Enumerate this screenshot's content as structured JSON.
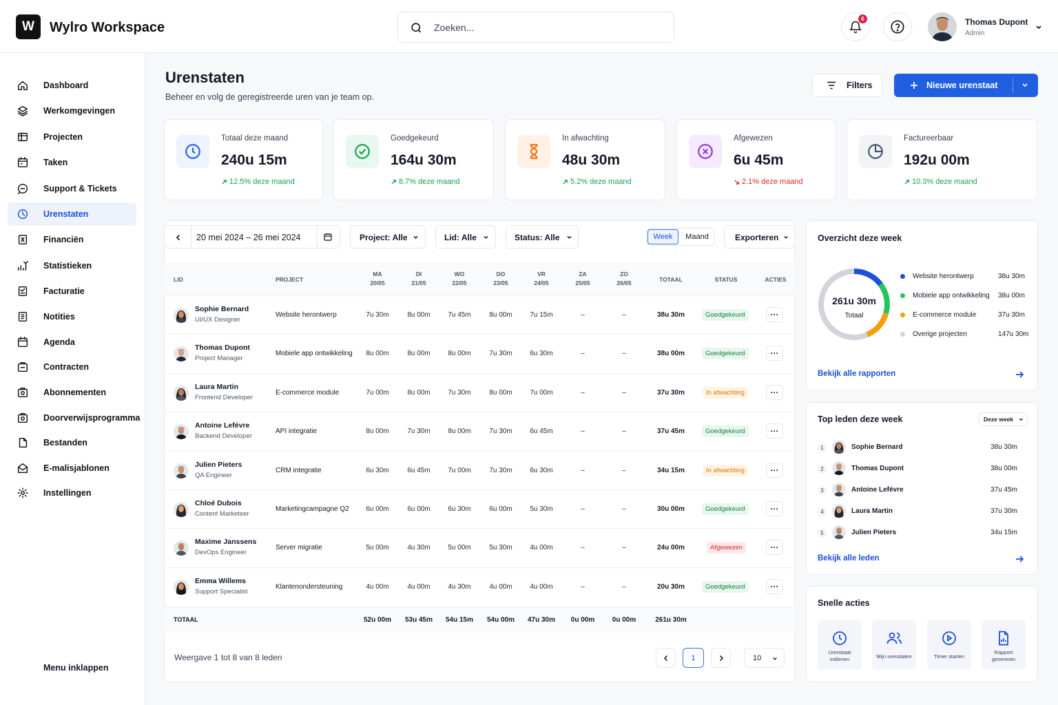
{
  "app": {
    "logo_letter": "W",
    "name": "Wylro Workspace"
  },
  "search": {
    "placeholder": "Zoeken..."
  },
  "notifications": {
    "count": "6"
  },
  "user": {
    "name": "Thomas Dupont",
    "role": "Admin"
  },
  "sidebar": {
    "items": [
      {
        "label": "Dashboard",
        "icon": "home-icon"
      },
      {
        "label": "Werkomgevingen",
        "icon": "layers-icon"
      },
      {
        "label": "Projecten",
        "icon": "folder-icon"
      },
      {
        "label": "Taken",
        "icon": "calendar-icon"
      },
      {
        "label": "Support & Tickets",
        "icon": "chat-icon"
      },
      {
        "label": "Urenstaten",
        "icon": "clock-icon",
        "active": true
      },
      {
        "label": "Financiën",
        "icon": "finance-icon"
      },
      {
        "label": "Statistieken",
        "icon": "stats-icon"
      },
      {
        "label": "Facturatie",
        "icon": "invoice-icon"
      },
      {
        "label": "Notities",
        "icon": "notes-icon"
      },
      {
        "label": "Agenda",
        "icon": "agenda-icon"
      },
      {
        "label": "Contracten",
        "icon": "contract-icon"
      },
      {
        "label": "Abonnementen",
        "icon": "subscription-icon"
      },
      {
        "label": "Doorverwijsprogramma",
        "icon": "referral-icon"
      },
      {
        "label": "Bestanden",
        "icon": "files-icon"
      },
      {
        "label": "E-malisjablonen",
        "icon": "mail-icon"
      },
      {
        "label": "Instellingen",
        "icon": "gear-icon"
      }
    ],
    "collapse_label": "Menu inklappen"
  },
  "page": {
    "title": "Urenstaten",
    "subtitle": "Beheer en volg de geregistreerde uren van je team op.",
    "filters_label": "Filters",
    "new_label": "Nieuwe urenstaat"
  },
  "stats": [
    {
      "label": "Totaal deze maand",
      "value": "240u 15m",
      "trend": "12.5% deze maand",
      "color": "#2563eb"
    },
    {
      "label": "Goedgekeurd",
      "value": "164u 30m",
      "trend": "8.7% deze maand",
      "color": "#16a34a"
    },
    {
      "label": "In afwachting",
      "value": "48u 30m",
      "trend": "5.2% deze maand",
      "color": "#f97316"
    },
    {
      "label": "Afgewezen",
      "value": "6u 45m",
      "trend": "2.1% deze maand",
      "color": "#9333ea"
    },
    {
      "label": "Factureerbaar",
      "value": "192u 00m",
      "trend": "10.3% deze maand",
      "color": "#475569"
    }
  ],
  "controls": {
    "date_range": "20 mei 2024 – 26 mei 2024",
    "project": "Project: Alle",
    "member": "Lid: Alle",
    "status": "Status: Alle",
    "week": "Week",
    "month": "Maand",
    "export": "Exporteren"
  },
  "table": {
    "headers": {
      "member": "LID",
      "project": "PROJECT",
      "total": "TOTAAL",
      "status": "STATUS",
      "actions": "ACTIES"
    },
    "days": [
      {
        "d": "MA",
        "date": "20/05"
      },
      {
        "d": "DI",
        "date": "21/05"
      },
      {
        "d": "WO",
        "date": "22/05"
      },
      {
        "d": "DO",
        "date": "23/05"
      },
      {
        "d": "VR",
        "date": "24/05"
      },
      {
        "d": "ZA",
        "date": "25/05"
      },
      {
        "d": "ZO",
        "date": "26/05"
      }
    ],
    "rows": [
      {
        "name": "Sophie Bernard",
        "role": "UI/UX Designer",
        "project": "Website herontwerp",
        "hours": [
          "7u 30m",
          "8u 00m",
          "7u 45m",
          "8u 00m",
          "7u 15m",
          "–",
          "–"
        ],
        "total": "38u 30m",
        "status": "Goedgekeurd"
      },
      {
        "name": "Thomas Dupont",
        "role": "Project Manager",
        "project": "Mobiele app ontwikkeling",
        "hours": [
          "8u 00m",
          "8u 00m",
          "8u 00m",
          "7u 30m",
          "6u 30m",
          "–",
          "–"
        ],
        "total": "38u 00m",
        "status": "Goedgekeurd"
      },
      {
        "name": "Laura Martin",
        "role": "Frontend Developer",
        "project": "E-commerce module",
        "hours": [
          "7u 00m",
          "8u 00m",
          "7u 30m",
          "8u 00m",
          "7u 00m",
          "–",
          "–"
        ],
        "total": "37u 30m",
        "status": "In afwachting"
      },
      {
        "name": "Antoine Lefévre",
        "role": "Backend Developer",
        "project": "API integratie",
        "hours": [
          "8u 00m",
          "7u 30m",
          "8u 00m",
          "7u 30m",
          "6u 45m",
          "–",
          "–"
        ],
        "total": "37u 45m",
        "status": "Goedgekeurd"
      },
      {
        "name": "Julien Pieters",
        "role": "QA Engineer",
        "project": "CRM integratie",
        "hours": [
          "6u 30m",
          "6u 45m",
          "7u 00m",
          "7u 30m",
          "6u 30m",
          "–",
          "–"
        ],
        "total": "34u 15m",
        "status": "In afwachting"
      },
      {
        "name": "Chloé Dubois",
        "role": "Content Marketeer",
        "project": "Marketingcampagne Q2",
        "hours": [
          "6u 00m",
          "6u 00m",
          "6u 30m",
          "6u 00m",
          "5u 30m",
          "–",
          "–"
        ],
        "total": "30u 00m",
        "status": "Goedgekeurd"
      },
      {
        "name": "Maxime Janssens",
        "role": "DevOps Engineer",
        "project": "Server migratie",
        "hours": [
          "5u 00m",
          "4u 30m",
          "5u 00m",
          "5u 30m",
          "4u 00m",
          "–",
          "–"
        ],
        "total": "24u 00m",
        "status": "Afgewezen"
      },
      {
        "name": "Emma Willems",
        "role": "Support Specialist",
        "project": "Klantenondersteuning",
        "hours": [
          "4u 00m",
          "4u 00m",
          "4u 30m",
          "4u 00m",
          "4u 00m",
          "–",
          "–"
        ],
        "total": "20u 30m",
        "status": "Goedgekeurd"
      }
    ],
    "footer": {
      "label": "TOTAAL",
      "hours": [
        "52u 00m",
        "53u 45m",
        "54u 15m",
        "54u 00m",
        "47u 30m",
        "0u 00m",
        "0u 00m"
      ],
      "total": "261u 30m"
    }
  },
  "pagination": {
    "summary": "Weergave 1 tot 8 van 8 leden",
    "page": "1",
    "per_page": "10"
  },
  "week_overview": {
    "title": "Overzicht deze week",
    "total": "261u 30m",
    "total_label": "Totaal",
    "link": "Bekijk alle rapporten",
    "items": [
      {
        "label": "Website herontwerp",
        "value": "38u 30m",
        "color": "#1d4ed8",
        "hours": 38.5
      },
      {
        "label": "Mobiele app ontwikkeling",
        "value": "38u 00m",
        "color": "#22c55e",
        "hours": 38
      },
      {
        "label": "E-commerce module",
        "value": "37u 30m",
        "color": "#f59e0b",
        "hours": 37.5
      },
      {
        "label": "Overige projecten",
        "value": "147u 30m",
        "color": "#d1d5db",
        "hours": 147.5
      }
    ]
  },
  "top_members": {
    "title": "Top leden deze week",
    "filter": "Deze week",
    "link": "Bekijk alle leden",
    "items": [
      {
        "rank": "1",
        "name": "Sophie Bernard",
        "hours": "38u 30m"
      },
      {
        "rank": "2",
        "name": "Thomas Dupont",
        "hours": "38u 00m"
      },
      {
        "rank": "3",
        "name": "Antoine Lefévre",
        "hours": "37u 45m"
      },
      {
        "rank": "4",
        "name": "Laura Martin",
        "hours": "37u 30m"
      },
      {
        "rank": "5",
        "name": "Julien Pieters",
        "hours": "34u 15m"
      }
    ]
  },
  "quick_actions": {
    "title": "Snelle acties",
    "items": [
      "Urenstaat indienen",
      "Mijn urenstaten",
      "Timer starten",
      "Rapport genereren"
    ]
  }
}
